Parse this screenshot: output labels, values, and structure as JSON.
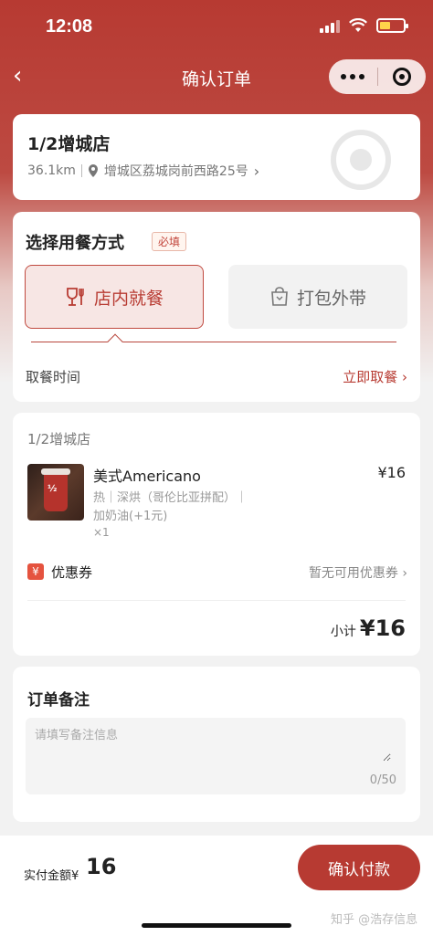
{
  "status_bar": {
    "time": "12:08"
  },
  "nav": {
    "title": "确认订单",
    "back_icon": "‹"
  },
  "store": {
    "name": "1/2增城店",
    "distance": "36.1km",
    "address": "增城区荔城岗前西路25号",
    "chevron": "›"
  },
  "dining": {
    "title": "选择用餐方式",
    "required": "必填",
    "dine_in": "店内就餐",
    "takeout": "打包外带",
    "pickup_label": "取餐时间",
    "pickup_value": "立即取餐 ›"
  },
  "order": {
    "store_name": "1/2增城店",
    "item": {
      "name": "美式Americano",
      "price": "¥16",
      "options": "热｜深烘（哥伦比亚拼配）｜",
      "options2": "加奶油(+1元)",
      "qty": "×1",
      "logo": "½"
    },
    "coupon_icon": "¥",
    "coupon_label": "优惠券",
    "coupon_value": "暂无可用优惠券 ›",
    "subtotal_label": "小计",
    "subtotal_value": "¥16"
  },
  "note": {
    "title": "订单备注",
    "placeholder": "请填写备注信息",
    "count": "0/50"
  },
  "footer": {
    "total_label": "实付金额¥",
    "total_value": "16",
    "pay_button": "确认付款",
    "watermark": "知乎 @浩存信息"
  },
  "colors": {
    "brand": "#b73a32",
    "accent_text": "#b83c33"
  }
}
